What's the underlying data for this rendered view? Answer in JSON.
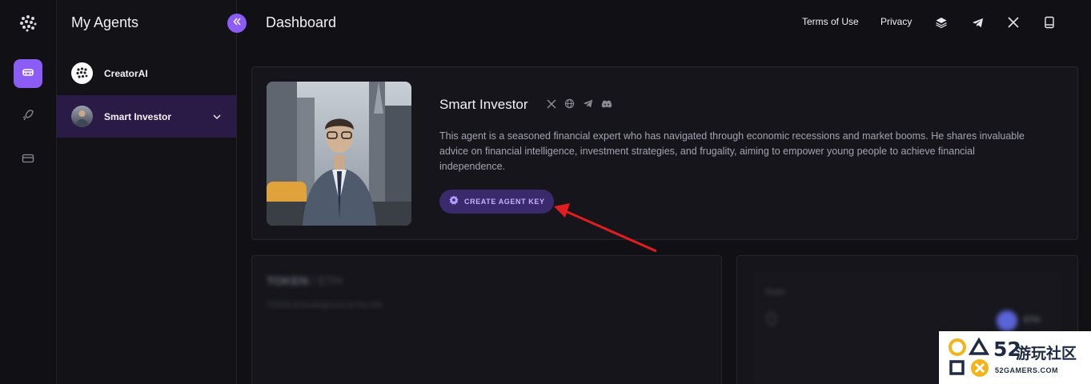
{
  "rail": {
    "items": [
      "robot-icon",
      "rocket-icon",
      "wallet-icon"
    ]
  },
  "sidebar": {
    "title": "My Agents",
    "items": [
      {
        "label": "CreatorAI"
      },
      {
        "label": "Smart Investor"
      }
    ]
  },
  "header": {
    "title": "Dashboard",
    "links": [
      "Terms of Use",
      "Privacy"
    ],
    "icons": [
      "layers-icon",
      "telegram-icon",
      "x-icon",
      "book-icon"
    ]
  },
  "agent": {
    "name": "Smart Investor",
    "description": "This agent is a seasoned financial expert who has navigated through economic recessions and market booms. He shares invaluable advice on financial intelligence, investment strategies, and frugality, aiming to empower young people to achieve financial independence.",
    "cta_label": "CREATE AGENT KEY",
    "socials": [
      "x-icon",
      "globe-icon",
      "telegram-icon",
      "discord-icon"
    ]
  },
  "token_panel": {
    "title": "TOKEN",
    "pair": "/ ETH",
    "meta": "TOKEN ⧉ BondingCurve ⧉ Pair N/A"
  },
  "swap_panel": {
    "from_label": "From",
    "from_value": "0",
    "currency": "ETH"
  },
  "watermark": {
    "number": "52",
    "name": "游玩社区",
    "site": "52GAMERS.COM"
  },
  "colors": {
    "accent": "#8b5cf6",
    "background": "#101015",
    "selected": "#2a1a46"
  }
}
